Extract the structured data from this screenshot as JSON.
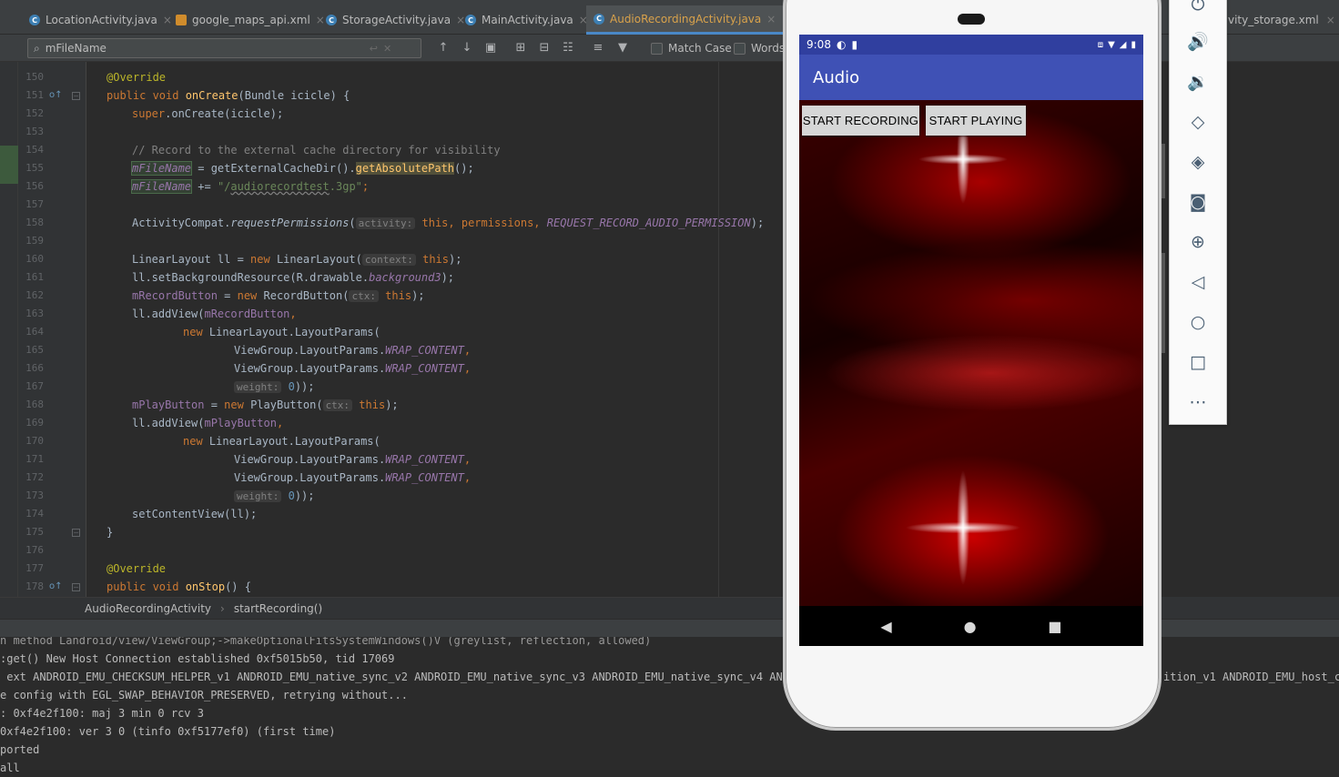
{
  "tabs": [
    {
      "label": "LocationActivity.java",
      "type": "java",
      "active": false
    },
    {
      "label": "google_maps_api.xml",
      "type": "xml",
      "active": false
    },
    {
      "label": "StorageActivity.java",
      "type": "java",
      "active": false
    },
    {
      "label": "MainActivity.java",
      "type": "java",
      "active": false
    },
    {
      "label": "AudioRecordingActivity.java",
      "type": "java",
      "active": true
    }
  ],
  "right_tab_label": "vity_storage.xml",
  "search": {
    "value": "mFileName",
    "match_case": "Match Case",
    "words": "Words"
  },
  "code_lines": [
    {
      "num": "150"
    },
    {
      "num": "151"
    },
    {
      "num": "152"
    },
    {
      "num": "153"
    },
    {
      "num": "154"
    },
    {
      "num": "155"
    },
    {
      "num": "156"
    },
    {
      "num": "157"
    },
    {
      "num": "158"
    },
    {
      "num": "159"
    },
    {
      "num": "160"
    },
    {
      "num": "161"
    },
    {
      "num": "162"
    },
    {
      "num": "163"
    },
    {
      "num": "164"
    },
    {
      "num": "165"
    },
    {
      "num": "166"
    },
    {
      "num": "167"
    },
    {
      "num": "168"
    },
    {
      "num": "169"
    },
    {
      "num": "170"
    },
    {
      "num": "171"
    },
    {
      "num": "172"
    },
    {
      "num": "173"
    },
    {
      "num": "174"
    },
    {
      "num": "175"
    },
    {
      "num": "176"
    },
    {
      "num": "177"
    },
    {
      "num": "178"
    }
  ],
  "code": {
    "override": "@Override",
    "l151_public": "public void ",
    "l151_fn": "onCreate",
    "l151_rest": "(Bundle icicle) {",
    "l152_super": "super",
    "l152_rest": ".onCreate(icicle);",
    "l154": "// Record to the external cache directory for visibility",
    "l155_var": "mFileName",
    "l155_mid": " = getExternalCacheDir().",
    "l155_call": "getAbsolutePath",
    "l155_end": "();",
    "l156_var": "mFileName",
    "l156_op": " += ",
    "l156_str_a": "\"/",
    "l156_str_b": "audiorecordtest",
    "l156_str_c": ".3gp\"",
    "l156_end": ";",
    "l158_a": "ActivityCompat.",
    "l158_call": "requestPermissions",
    "l158_b": "(",
    "l158_hint": "activity:",
    "l158_this": " this",
    "l158_c": ", permissions, ",
    "l158_const": "REQUEST_RECORD_AUDIO_PERMISSION",
    "l158_end": ");",
    "l160_a": "LinearLayout ll = ",
    "l160_new": "new",
    "l160_b": " LinearLayout(",
    "l160_hint": "context:",
    "l160_this": " this",
    "l160_end": ");",
    "l161_a": "ll.setBackgroundResource(R.drawable.",
    "l161_fd": "background3",
    "l161_end": ");",
    "l162_var": "mRecordButton",
    "l162_a": " = ",
    "l162_new": "new",
    "l162_b": " RecordButton(",
    "l162_hint": "ctx:",
    "l162_this": " this",
    "l162_end": ");",
    "l163_a": "ll.addView(",
    "l163_var": "mRecordButton",
    "l163_end": ",",
    "l164_new": "new",
    "l164_a": " LinearLayout.LayoutParams(",
    "lp_a": "ViewGroup.LayoutParams.",
    "lp_const": "WRAP_CONTENT",
    "lp_end": ",",
    "weight_hint": "weight:",
    "weight_val": " 0",
    "weight_end": "));",
    "l168_var": "mPlayButton",
    "l168_a": " = ",
    "l168_new": "new",
    "l168_b": " PlayButton(",
    "l168_hint": "ctx:",
    "l168_this": " this",
    "l168_end": ");",
    "l169_a": "ll.addView(",
    "l169_var": "mPlayButton",
    "l169_end": ",",
    "l174": "setContentView(ll);",
    "l175": "}",
    "l178_public": "public void ",
    "l178_fn": "onStop",
    "l178_rest": "() {"
  },
  "breadcrumb": {
    "class": "AudioRecordingActivity",
    "sep": "›",
    "method": "startRecording()"
  },
  "log_lines": [
    "n method Landroid/view/ViewGroup;->makeOptionalFitsSystemWindows()V (greylist, reflection, allowed)",
    ":get() New Host Connection established 0xf5015b50, tid 17069",
    " ext ANDROID_EMU_CHECKSUM_HELPER_v1 ANDROID_EMU_native_sync_v2 ANDROID_EMU_native_sync_v3 ANDROID_EMU_native_sync_v4 ANDROI",
    "e config with EGL_SWAP_BEHAVIOR_PRESERVED, retrying without...",
    ": 0xf4e2f100: maj 3 min 0 rcv 3",
    "0xf4e2f100: ver 3 0 (tinfo 0xf5177ef0) (first time)",
    "ported",
    "all"
  ],
  "log_right": "ition_v1 ANDROID_EMU_host_co",
  "phone": {
    "time": "9:08",
    "app_title": "Audio",
    "btn_record": "START RECORDING",
    "btn_play": "START PLAYING"
  },
  "colors": {
    "status_bar": "#303f9f",
    "app_bar": "#3f51b5",
    "accent_tab": "#4a88c7"
  }
}
